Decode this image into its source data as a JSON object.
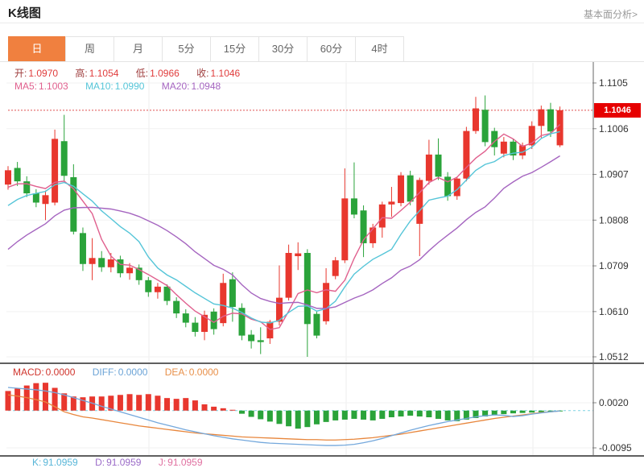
{
  "header": {
    "title": "K线图",
    "link": "基本面分析>"
  },
  "tabs": {
    "items": [
      "日",
      "周",
      "月",
      "5分",
      "15分",
      "30分",
      "60分",
      "4时"
    ],
    "active_index": 0
  },
  "legend_ohlc": {
    "open_label": "开:",
    "open_value": "1.0970",
    "high_label": "高:",
    "high_value": "1.1054",
    "low_label": "低:",
    "low_value": "1.0966",
    "close_label": "收:",
    "close_value": "1.1046"
  },
  "legend_ma": {
    "ma5_label": "MA5:",
    "ma5_value": "1.1003",
    "ma10_label": "MA10:",
    "ma10_value": "1.0990",
    "ma20_label": "MA20:",
    "ma20_value": "1.0948"
  },
  "legend_macd": {
    "macd_label": "MACD:",
    "macd_value": "0.0000",
    "diff_label": "DIFF:",
    "diff_value": "0.0000",
    "dea_label": "DEA:",
    "dea_value": "0.0000"
  },
  "legend_kdj": {
    "k_label": "K:",
    "k_value": "91.0959",
    "d_label": "D:",
    "d_value": "91.0959",
    "j_label": "J:",
    "j_value": "91.0959"
  },
  "price_axis": {
    "ticks": [
      "1.1105",
      "1.1006",
      "1.0907",
      "1.0808",
      "1.0709",
      "1.0610",
      "1.0512"
    ],
    "current": "1.1046"
  },
  "macd_axis": {
    "ticks": [
      "0.0020",
      "-0.0095"
    ]
  },
  "colors": {
    "up": "#e8372e",
    "down": "#2aa33a",
    "ma5": "#e0608e",
    "ma10": "#55c5d8",
    "ma20": "#a565c0",
    "diff_line": "#74a8dc",
    "dea_line": "#e8863c",
    "ohlc_label": "#9e3d3d",
    "ohlc_value": "#e03c3c",
    "macd_text": "#d0342c",
    "diff_text": "#6ba3d6",
    "dea_text": "#e8904a",
    "k_text": "#58b6d8",
    "d_text": "#9b6bc8",
    "j_text": "#e070a0",
    "tab_active_bg": "#f0803f",
    "price_tag_bg": "#e60000",
    "current_line": "#e05050",
    "macd_zero_line": "#7fd4e4",
    "axis_text": "#333333"
  },
  "chart_data": {
    "type": "candlestick",
    "title": "K线图 日K (EUR/USD style daily candles)",
    "panels": [
      "price with MA5/MA10/MA20",
      "MACD"
    ],
    "price_axis_ticks": [
      1.1105,
      1.1006,
      1.0907,
      1.0808,
      1.0709,
      1.061,
      1.0512
    ],
    "macd_axis_ticks": [
      0.002,
      -0.0095
    ],
    "current_price": 1.1046,
    "last_candle": {
      "open": 1.097,
      "high": 1.1054,
      "low": 1.0966,
      "close": 1.1046
    },
    "candles_ohlc": [
      [
        1.0885,
        1.0925,
        1.0874,
        1.0916
      ],
      [
        1.0921,
        1.0934,
        1.0882,
        1.0892
      ],
      [
        1.0892,
        1.0903,
        1.0858,
        1.0866
      ],
      [
        1.0866,
        1.0875,
        1.0836,
        1.0846
      ],
      [
        1.0843,
        1.0872,
        1.0808,
        1.0862
      ],
      [
        1.0846,
        1.1004,
        1.084,
        1.0984
      ],
      [
        1.0979,
        1.1036,
        1.0893,
        1.0904
      ],
      [
        1.0901,
        1.0929,
        1.0777,
        1.0783
      ],
      [
        1.078,
        1.0792,
        1.0698,
        1.0713
      ],
      [
        1.0713,
        1.0769,
        1.0678,
        1.0726
      ],
      [
        1.0726,
        1.0741,
        1.0696,
        1.0706
      ],
      [
        1.0706,
        1.0737,
        1.0695,
        1.0723
      ],
      [
        1.0723,
        1.0731,
        1.0684,
        1.0693
      ],
      [
        1.0693,
        1.0715,
        1.0679,
        1.0705
      ],
      [
        1.0705,
        1.0712,
        1.0668,
        1.0678
      ],
      [
        1.0678,
        1.0685,
        1.0642,
        1.0652
      ],
      [
        1.0652,
        1.0672,
        1.0638,
        1.0664
      ],
      [
        1.0664,
        1.0669,
        1.0624,
        1.0633
      ],
      [
        1.0633,
        1.0641,
        1.0596,
        1.0606
      ],
      [
        1.0606,
        1.0615,
        1.0576,
        1.0586
      ],
      [
        1.0586,
        1.0598,
        1.0556,
        1.0566
      ],
      [
        1.0566,
        1.0612,
        1.0548,
        1.0603
      ],
      [
        1.061,
        1.0617,
        1.056,
        1.0572
      ],
      [
        1.0585,
        1.0692,
        1.0578,
        1.0672
      ],
      [
        1.068,
        1.0695,
        1.0588,
        1.062
      ],
      [
        1.0618,
        1.0628,
        1.0548,
        1.0558
      ],
      [
        1.056,
        1.057,
        1.053,
        1.0546
      ],
      [
        1.0548,
        1.0576,
        1.0518,
        1.0544
      ],
      [
        1.0552,
        1.0592,
        1.054,
        1.0588
      ],
      [
        1.0588,
        1.071,
        1.058,
        1.064
      ],
      [
        1.064,
        1.0755,
        1.0634,
        1.0737
      ],
      [
        1.073,
        1.076,
        1.07,
        1.0736
      ],
      [
        1.0737,
        1.0745,
        1.0512,
        1.0583
      ],
      [
        1.0605,
        1.0612,
        1.0552,
        1.0558
      ],
      [
        1.0589,
        1.0704,
        1.0582,
        1.0672
      ],
      [
        1.0687,
        1.0728,
        1.068,
        1.0721
      ],
      [
        1.0721,
        1.092,
        1.0715,
        1.0855
      ],
      [
        1.0855,
        1.0933,
        1.0812,
        1.082
      ],
      [
        1.0829,
        1.084,
        1.0728,
        1.0758
      ],
      [
        1.0758,
        1.08,
        1.0748,
        1.0792
      ],
      [
        1.0792,
        1.0848,
        1.077,
        1.0842
      ],
      [
        1.0842,
        1.088,
        1.0815,
        1.0848
      ],
      [
        1.0845,
        1.0912,
        1.0838,
        1.0905
      ],
      [
        1.0905,
        1.0915,
        1.084,
        1.0848
      ],
      [
        1.08,
        1.09,
        1.073,
        1.0895
      ],
      [
        1.0893,
        1.0982,
        1.0885,
        1.095
      ],
      [
        1.095,
        1.0985,
        1.0895,
        1.0902
      ],
      [
        1.0902,
        1.0912,
        1.085,
        1.086
      ],
      [
        1.086,
        1.0902,
        1.0852,
        1.0898
      ],
      [
        1.0898,
        1.101,
        1.0892,
        1.1001
      ],
      [
        1.1001,
        1.1075,
        1.0995,
        1.105
      ],
      [
        1.1047,
        1.1078,
        1.0968,
        1.0977
      ],
      [
        1.1001,
        1.1008,
        1.0948,
        1.0966
      ],
      [
        1.0952,
        1.0988,
        1.0944,
        1.0978
      ],
      [
        1.0978,
        1.0984,
        1.0938,
        1.0948
      ],
      [
        1.0948,
        1.0976,
        1.094,
        1.097
      ],
      [
        1.097,
        1.1022,
        1.0962,
        1.1012
      ],
      [
        1.1012,
        1.1056,
        1.0986,
        1.1048
      ],
      [
        1.1048,
        1.1062,
        1.0988,
        1.1
      ],
      [
        1.097,
        1.1054,
        1.0966,
        1.1046
      ]
    ],
    "prehistory_closes": [
      1.056,
      1.058,
      1.06,
      1.062,
      1.064,
      1.066,
      1.068,
      1.07,
      1.072,
      1.074,
      1.076,
      1.078,
      1.08,
      1.082,
      1.084,
      1.0855,
      1.0865,
      1.0875,
      1.0885
    ],
    "ma_windows": [
      5,
      10,
      20
    ],
    "macd": {
      "hist": [
        0.005,
        0.0056,
        0.0064,
        0.007,
        0.0071,
        0.0058,
        0.0044,
        0.0036,
        0.0034,
        0.0036,
        0.0036,
        0.0038,
        0.004,
        0.0042,
        0.004,
        0.0042,
        0.0038,
        0.0032,
        0.003,
        0.0032,
        0.0026,
        0.0016,
        0.001,
        0.0006,
        0.0002,
        -0.0008,
        -0.0016,
        -0.0022,
        -0.0028,
        -0.0034,
        -0.004,
        -0.0046,
        -0.0042,
        -0.0035,
        -0.0029,
        -0.0025,
        -0.0023,
        -0.0021,
        -0.0023,
        -0.0025,
        -0.0021,
        -0.0017,
        -0.0015,
        -0.0013,
        -0.0015,
        -0.0017,
        -0.0021,
        -0.0025,
        -0.0027,
        -0.0023,
        -0.0019,
        -0.0015,
        -0.0011,
        -0.0009,
        -0.0007,
        -0.0006,
        -0.0005,
        -0.0004,
        -0.0003,
        -0.0002
      ],
      "diff": [
        0.0059,
        0.0057,
        0.0055,
        0.0053,
        0.005,
        0.0046,
        0.004,
        0.0033,
        0.0026,
        0.0019,
        0.0011,
        0.0004,
        -0.0003,
        -0.001,
        -0.0017,
        -0.0024,
        -0.0031,
        -0.0037,
        -0.0043,
        -0.0049,
        -0.0054,
        -0.0059,
        -0.0064,
        -0.0068,
        -0.0072,
        -0.0075,
        -0.0078,
        -0.0081,
        -0.0083,
        -0.0084,
        -0.0085,
        -0.0086,
        -0.0087,
        -0.0088,
        -0.0089,
        -0.0089,
        -0.0088,
        -0.0086,
        -0.0082,
        -0.0077,
        -0.0071,
        -0.0064,
        -0.0057,
        -0.005,
        -0.0044,
        -0.0038,
        -0.0033,
        -0.0028,
        -0.0024,
        -0.002,
        -0.0016,
        -0.0013,
        -0.0011,
        -0.0012,
        -0.0015,
        -0.0013,
        -0.0009,
        -0.0006,
        -0.0003,
        -0.0001
      ],
      "dea": [
        0.004,
        0.0037,
        0.0033,
        0.0028,
        0.0022,
        0.001,
        -0.0003,
        -0.001,
        -0.0016,
        -0.0019,
        -0.0023,
        -0.0027,
        -0.0031,
        -0.0035,
        -0.0039,
        -0.0042,
        -0.0045,
        -0.0048,
        -0.0051,
        -0.0054,
        -0.0057,
        -0.0059,
        -0.0061,
        -0.0063,
        -0.0065,
        -0.0067,
        -0.0068,
        -0.0069,
        -0.007,
        -0.0071,
        -0.0072,
        -0.0073,
        -0.0074,
        -0.0074,
        -0.0075,
        -0.0075,
        -0.0074,
        -0.0073,
        -0.0071,
        -0.0069,
        -0.0066,
        -0.0063,
        -0.006,
        -0.0056,
        -0.0052,
        -0.0048,
        -0.0044,
        -0.004,
        -0.0036,
        -0.0032,
        -0.0028,
        -0.0024,
        -0.002,
        -0.0017,
        -0.0014,
        -0.0011,
        -0.0008,
        -0.0005,
        -0.0003,
        -0.0001
      ]
    }
  }
}
